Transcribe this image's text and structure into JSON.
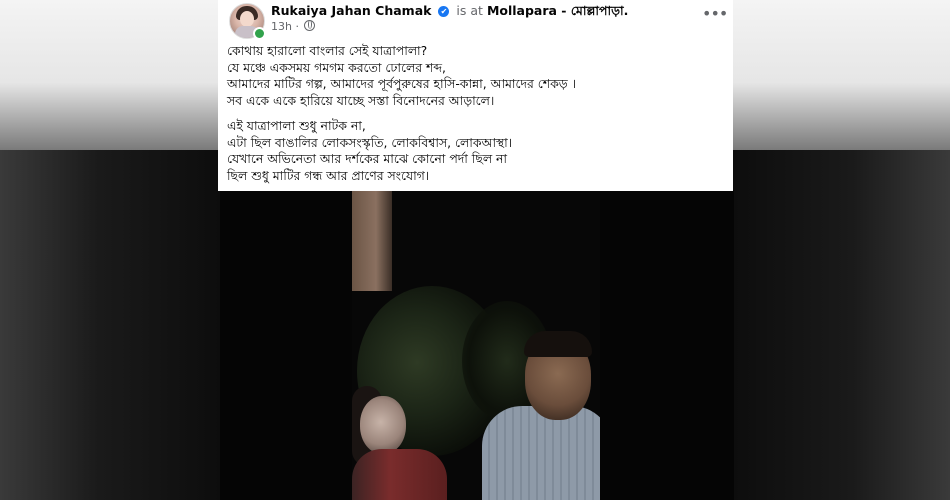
{
  "post": {
    "author": "Rukaiya Jahan Chamak",
    "verified_mark": "✔",
    "is_at": "is at",
    "place": "Mollapara - মোল্লাপাড়া.",
    "time": "13h ·",
    "more_label": "•••",
    "paragraphs": [
      [
        "কোথায় হারালো বাংলার সেই যাত্রাপালা?",
        "যে মঞ্চে একসময় গমগম করতো ঢোলের শব্দ,",
        "আমাদের মাটির গল্প, আমাদের পূর্বপুরুষের হাসি-কান্না, আমাদের শেকড় ।",
        "সব একে একে হারিয়ে যাচ্ছে সস্তা বিনোদনের আড়ালে।"
      ],
      [
        "এই যাত্রাপালা শুধু নাটক না,",
        "এটা ছিল বাঙালির লোকসংস্কৃতি, লোকবিশ্বাস, লোকআস্থা।",
        "যেখানে অভিনেতা আর দর্শকের মাঝে কোনো পর্দা ছিল না",
        "ছিল শুধু মাটির গন্ধ আর প্রাণের সংযোগ।"
      ]
    ]
  },
  "icons": {
    "verified": "verified-badge-icon",
    "privacy": "globe-icon",
    "more": "more-horizontal-icon",
    "online": "online-status-dot"
  },
  "colors": {
    "card_bg": "#ffffff",
    "text": "#050505",
    "secondary_text": "#65676b",
    "verified_blue": "#1877f2",
    "online_green": "#31a24c"
  }
}
